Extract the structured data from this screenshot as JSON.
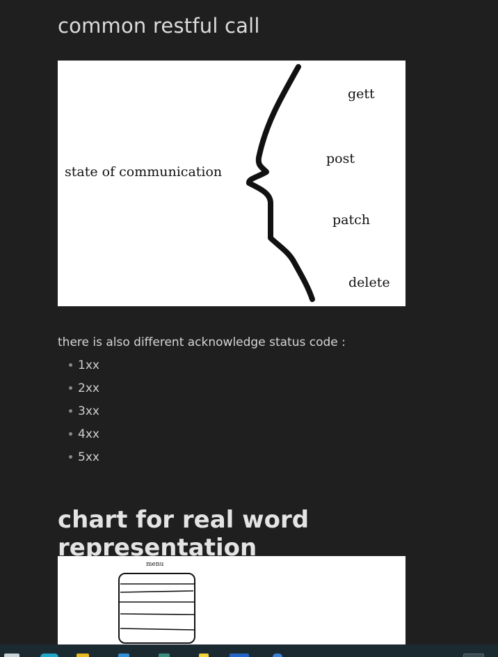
{
  "section1": {
    "heading": "common restful call",
    "diagram": {
      "left_label": "state of communication",
      "methods": [
        "gett",
        "post",
        "patch",
        "delete"
      ]
    }
  },
  "paragraph": "there is also different acknowledge status code :",
  "status_codes": [
    "1xx",
    "2xx",
    "3xx",
    "4xx",
    "5xx"
  ],
  "section2": {
    "heading": "chart for real word representation",
    "diagram": {
      "menu_label": "menu"
    }
  },
  "taskbar": {
    "icons": [
      "start-icon",
      "edge-icon",
      "file-explorer-icon",
      "store-icon",
      "terminal-icon",
      "notes-icon",
      "word-icon",
      "settings-icon",
      "overflow-icon"
    ]
  }
}
